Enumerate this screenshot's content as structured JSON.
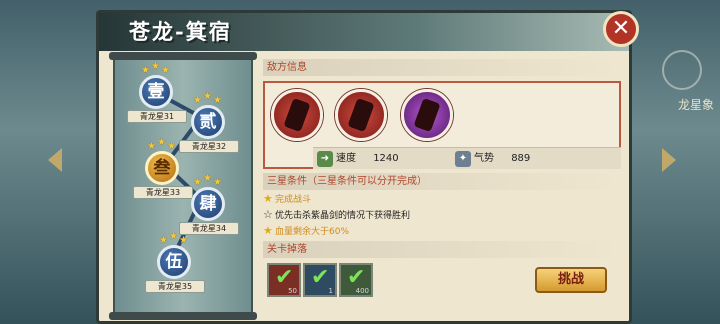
{
  "header": {
    "title": "苍龙-箕宿"
  },
  "background": {
    "right_label": "龙星象"
  },
  "map": {
    "nodes": [
      {
        "glyph": "壹",
        "label": "青龙星31",
        "stars": 3,
        "active": false
      },
      {
        "glyph": "贰",
        "label": "青龙星32",
        "stars": 3,
        "active": false
      },
      {
        "glyph": "叁",
        "label": "青龙星33",
        "stars": 3,
        "active": true
      },
      {
        "glyph": "肆",
        "label": "青龙星34",
        "stars": 3,
        "active": false
      },
      {
        "glyph": "伍",
        "label": "青龙星35",
        "stars": 3,
        "active": false
      }
    ]
  },
  "enemy_section": {
    "title": "敌方信息",
    "enemy_colors": [
      "#c33b32",
      "#c33b32",
      "#8e2aa8"
    ]
  },
  "stats": {
    "speed_label": "速度",
    "speed_value": "1240",
    "qishi_label": "气势",
    "qishi_value": "889"
  },
  "conditions": {
    "title": "三星条件（三星条件可以分开完成）",
    "items": [
      {
        "text": "完成战斗",
        "done": true
      },
      {
        "text": "优先击杀紫晶剑的情况下获得胜利",
        "done": false
      },
      {
        "text": "血量剩余大于60%",
        "done": true
      }
    ]
  },
  "drops": {
    "title": "关卡掉落",
    "items": [
      {
        "qty": "50",
        "color": "#7b2e24"
      },
      {
        "qty": "1",
        "color": "#2f4b61"
      },
      {
        "qty": "400",
        "color": "#3f5a3a"
      }
    ]
  },
  "fight_button": "挑战",
  "icons": {
    "close": "close-icon",
    "speed": "speed-icon",
    "qishi": "qishi-icon",
    "check": "check-icon"
  }
}
